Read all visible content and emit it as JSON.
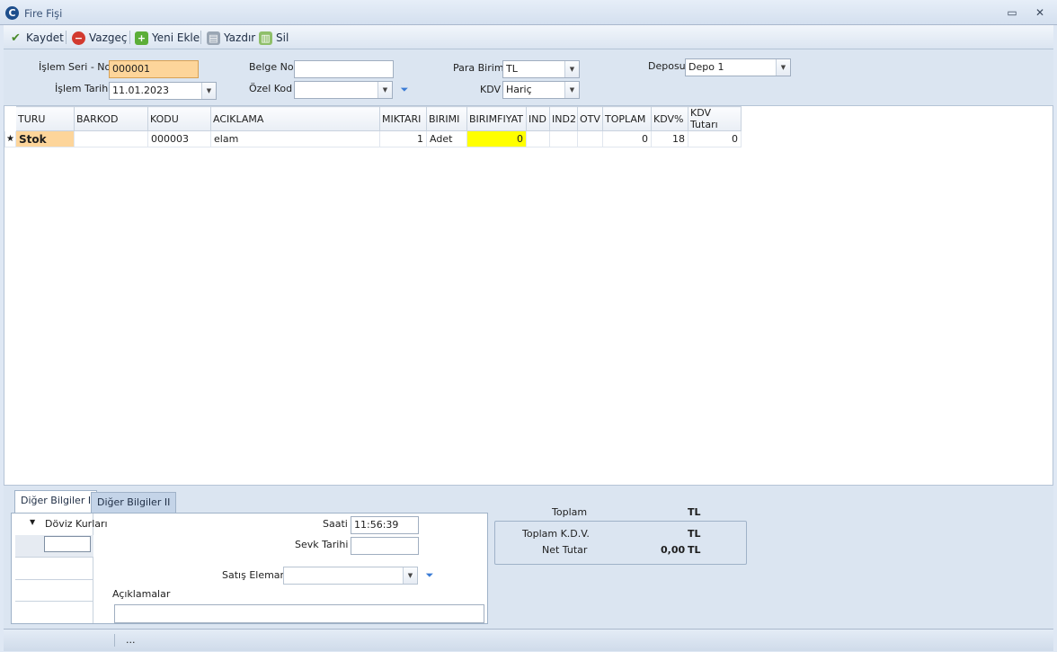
{
  "window": {
    "title": "Fire Fişi",
    "app_icon": "C"
  },
  "toolbar": {
    "save": "Kaydet",
    "cancel": "Vazgeç",
    "add": "Yeni Ekle",
    "print": "Yazdır",
    "delete": "Sil"
  },
  "header": {
    "islem_seri_no_label": "İşlem  Seri - No",
    "islem_seri_no": "000001",
    "islem_tarihi_label": "İşlem Tarihi",
    "islem_tarihi": "11.01.2023",
    "belge_no_label": "Belge No",
    "belge_no": "",
    "ozel_kod_label": "Özel Kod",
    "ozel_kod": "",
    "para_birimi_label": "Para Birimi",
    "para_birimi": "TL",
    "kdv_label": "KDV",
    "kdv": "Hariç",
    "deposu_label": "Deposu",
    "deposu": "Depo 1"
  },
  "grid": {
    "columns": [
      "TURU",
      "BARKOD",
      "KODU",
      "ACIKLAMA",
      "MIKTARI",
      "BIRIMI",
      "BIRIMFIYAT",
      "IND",
      "IND2",
      "OTV",
      "TOPLAM",
      "KDV%",
      "KDV Tutarı"
    ],
    "rows": [
      {
        "marker": "★",
        "turu": "Stok",
        "barkod": "",
        "kodu": "000003",
        "aciklama": "elam",
        "miktari": "1",
        "birimi": "Adet",
        "birimfiyat": "0",
        "ind": "",
        "ind2": "",
        "otv": "",
        "toplam": "0",
        "kdv_pct": "18",
        "kdv_tutari": "0"
      }
    ]
  },
  "footer": {
    "tab1": "Diğer Bilgiler I",
    "tab2": "Diğer Bilgiler II",
    "doviz_kurlari": "Döviz Kurları",
    "saati_label": "Saati",
    "saati": "11:56:39",
    "sevk_tarihi_label": "Sevk Tarihi",
    "sevk_tarihi": "",
    "satis_elemani_label": "Satış Elemanı",
    "satis_elemani": "",
    "aciklamalar_label": "Açıklamalar",
    "aciklamalar": "",
    "toplam_label": "Toplam",
    "toplam_currency": "TL",
    "toplam_kdv_label": "Toplam K.D.V.",
    "toplam_kdv_currency": "TL",
    "net_tutar_label": "Net Tutar",
    "net_tutar": "0,00",
    "net_tutar_currency": "TL"
  },
  "statusbar": {
    "text": "..."
  },
  "colors": {
    "seri_no_bg": "#fdd59a",
    "turu_cell_bg": "#fdd59a",
    "birimfiyat_bg": "#ffff00",
    "panel": "#dbe5f1"
  }
}
